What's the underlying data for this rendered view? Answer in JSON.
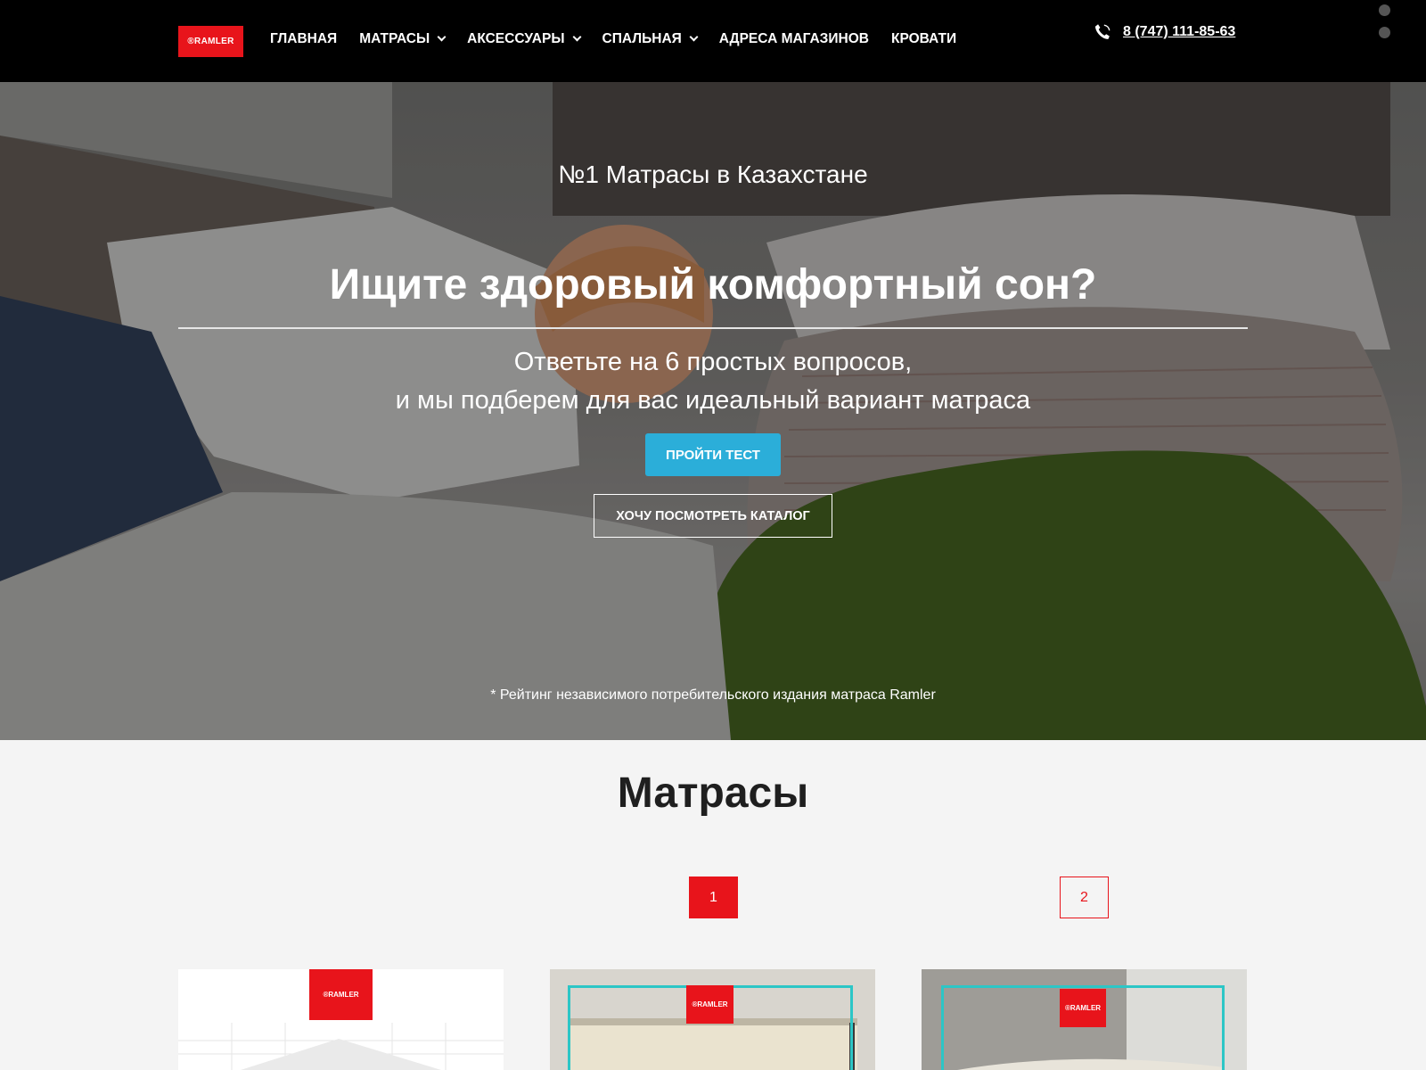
{
  "header": {
    "logo_text": "®RAMLER",
    "nav": [
      {
        "label": "ГЛАВНАЯ",
        "has_dropdown": false
      },
      {
        "label": "МАТРАСЫ",
        "has_dropdown": true
      },
      {
        "label": "АКСЕССУАРЫ",
        "has_dropdown": true
      },
      {
        "label": "СПАЛЬНАЯ",
        "has_dropdown": true
      },
      {
        "label": "АДРЕСА МАГАЗИНОВ",
        "has_dropdown": false
      },
      {
        "label": "КРОВАТИ",
        "has_dropdown": false
      }
    ],
    "phone": "8 (747) 111-85-63",
    "phone_icon": "phone-icon"
  },
  "hero": {
    "subtitle": "№1 Матрасы в Казахстане",
    "title": "Ищите здоровый комфортный сон?",
    "text_line1": "Ответьте на 6 простых вопросов,",
    "text_line2": "и мы подберем для вас идеальный вариант матраса",
    "btn_test": "ПРОЙТИ ТЕСТ",
    "btn_catalog": "ХОЧУ ПОСМОТРЕТЬ КАТАЛОГ",
    "note": "* Рейтинг независимого потребительского издания матраса Ramler"
  },
  "catalog": {
    "title": "Матрасы",
    "pages": [
      "1",
      "2"
    ],
    "active_page": "1",
    "cards": [
      {
        "logo": "®RAMLER"
      },
      {
        "logo": "®RAMLER"
      },
      {
        "logo": "®RAMLER"
      }
    ]
  },
  "colors": {
    "brand_red": "#e8141b",
    "accent_blue": "#2baed9",
    "header_bg": "#000000",
    "frame_teal": "#2cc6c6"
  }
}
